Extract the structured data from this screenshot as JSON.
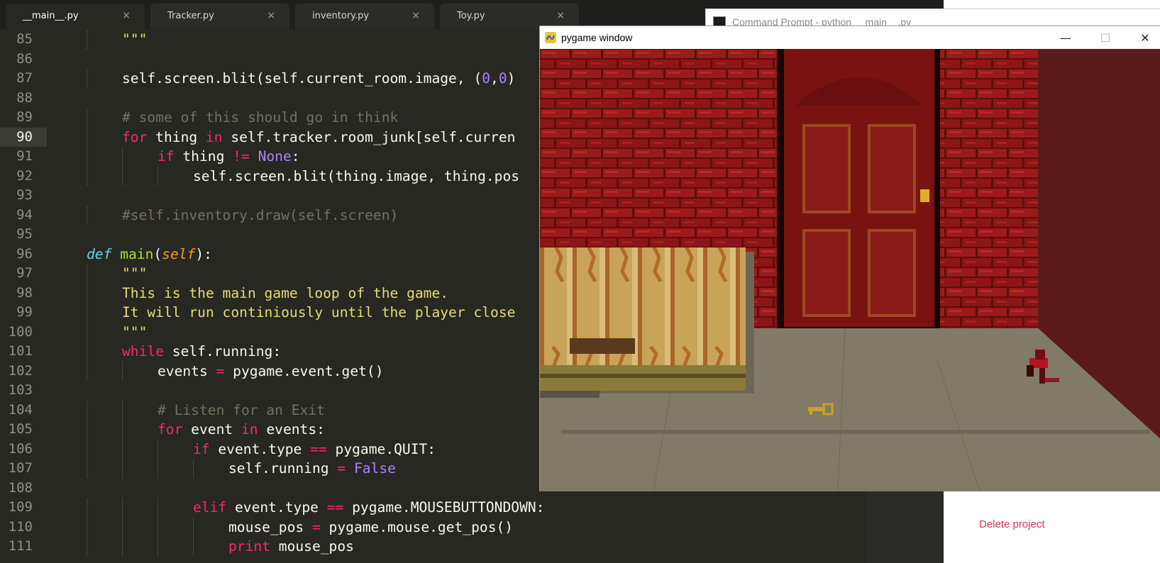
{
  "editor": {
    "tabs": [
      {
        "label": "__main__.py",
        "active": true
      },
      {
        "label": "Tracker.py",
        "active": false
      },
      {
        "label": "inventory.py",
        "active": false
      },
      {
        "label": "Toy.py",
        "active": false
      }
    ],
    "close_glyph": "×",
    "current_line": "90",
    "lines": [
      {
        "num": "85",
        "tokens": [
          [
            "s",
            "\"\"\""
          ]
        ]
      },
      {
        "num": "86",
        "tokens": []
      },
      {
        "num": "87",
        "tokens": [
          [
            "p",
            "self.screen.blit(self.current_room.image, ("
          ],
          [
            "n",
            "0"
          ],
          [
            "p",
            ","
          ],
          [
            "n",
            "0"
          ],
          [
            "p",
            ")"
          ]
        ]
      },
      {
        "num": "88",
        "tokens": []
      },
      {
        "num": "89",
        "tokens": [
          [
            "c",
            "# some of this should go in think"
          ]
        ]
      },
      {
        "num": "90",
        "tokens": [
          [
            "k",
            "for"
          ],
          [
            "p",
            " thing "
          ],
          [
            "k",
            "in"
          ],
          [
            "p",
            " self.tracker.room_junk[self.curren"
          ]
        ]
      },
      {
        "num": "91",
        "tokens": [
          [
            "k",
            "if"
          ],
          [
            "p",
            " thing "
          ],
          [
            "k",
            "!="
          ],
          [
            "p",
            " "
          ],
          [
            "n",
            "None"
          ],
          [
            "p",
            ":"
          ]
        ]
      },
      {
        "num": "92",
        "tokens": [
          [
            "p",
            "self.screen.blit(thing.image, thing.pos"
          ]
        ]
      },
      {
        "num": "93",
        "tokens": []
      },
      {
        "num": "94",
        "tokens": [
          [
            "c",
            "#self.inventory.draw(self.screen)"
          ]
        ]
      },
      {
        "num": "95",
        "tokens": []
      },
      {
        "num": "96",
        "tokens": [
          [
            "def",
            "def"
          ],
          [
            "p",
            " "
          ],
          [
            "fn",
            "main"
          ],
          [
            "p",
            "("
          ],
          [
            "self",
            "self"
          ],
          [
            "p",
            "):"
          ]
        ]
      },
      {
        "num": "97",
        "tokens": [
          [
            "s",
            "\"\"\""
          ]
        ]
      },
      {
        "num": "98",
        "tokens": [
          [
            "s",
            "This is the main game loop of the game."
          ]
        ]
      },
      {
        "num": "99",
        "tokens": [
          [
            "s",
            "It will run continiously until the player close"
          ]
        ]
      },
      {
        "num": "100",
        "tokens": [
          [
            "s",
            "\"\"\""
          ]
        ]
      },
      {
        "num": "101",
        "tokens": [
          [
            "k",
            "while"
          ],
          [
            "p",
            " self.running:"
          ]
        ]
      },
      {
        "num": "102",
        "tokens": [
          [
            "p",
            "events "
          ],
          [
            "k",
            "="
          ],
          [
            "p",
            " pygame.event.get()"
          ]
        ]
      },
      {
        "num": "103",
        "tokens": []
      },
      {
        "num": "104",
        "tokens": [
          [
            "c",
            "# Listen for an Exit"
          ]
        ]
      },
      {
        "num": "105",
        "tokens": [
          [
            "k",
            "for"
          ],
          [
            "p",
            " event "
          ],
          [
            "k",
            "in"
          ],
          [
            "p",
            " events:"
          ]
        ]
      },
      {
        "num": "106",
        "tokens": [
          [
            "k",
            "if"
          ],
          [
            "p",
            " event.type "
          ],
          [
            "k",
            "=="
          ],
          [
            "p",
            " pygame.QUIT:"
          ]
        ]
      },
      {
        "num": "107",
        "tokens": [
          [
            "p",
            "self.running "
          ],
          [
            "k",
            "="
          ],
          [
            "p",
            " "
          ],
          [
            "n",
            "False"
          ]
        ]
      },
      {
        "num": "108",
        "tokens": []
      },
      {
        "num": "109",
        "tokens": [
          [
            "k",
            "elif"
          ],
          [
            "p",
            " event.type "
          ],
          [
            "k",
            "=="
          ],
          [
            "p",
            " pygame.MOUSEBUTTONDOWN:"
          ]
        ]
      },
      {
        "num": "110",
        "tokens": [
          [
            "p",
            "mouse_pos "
          ],
          [
            "k",
            "="
          ],
          [
            "p",
            " pygame.mouse.get_pos()"
          ]
        ]
      },
      {
        "num": "111",
        "tokens": [
          [
            "k",
            "print"
          ],
          [
            "p",
            " mouse_pos"
          ]
        ]
      }
    ],
    "colors": {
      "background": "#272822",
      "keyword": "#f92672",
      "string": "#e6db74",
      "comment": "#75715e",
      "constant": "#ae81ff",
      "function": "#a6e22e",
      "def": "#66d9ef",
      "self": "#fd971f"
    }
  },
  "cmd_window": {
    "title": "Command Prompt - python __main__.py"
  },
  "pygame_window": {
    "title": "pygame window",
    "minimize_glyph": "—",
    "maximize_glyph": "☐",
    "close_glyph": "✕",
    "scene": {
      "brick_color": "#8b1515",
      "door_color": "#7a1212",
      "floor_color": "#807a66",
      "side_wall_color": "#5a1a1a",
      "key_color": "#c9a227"
    }
  },
  "side_panel": {
    "delete_label": "Delete project"
  }
}
